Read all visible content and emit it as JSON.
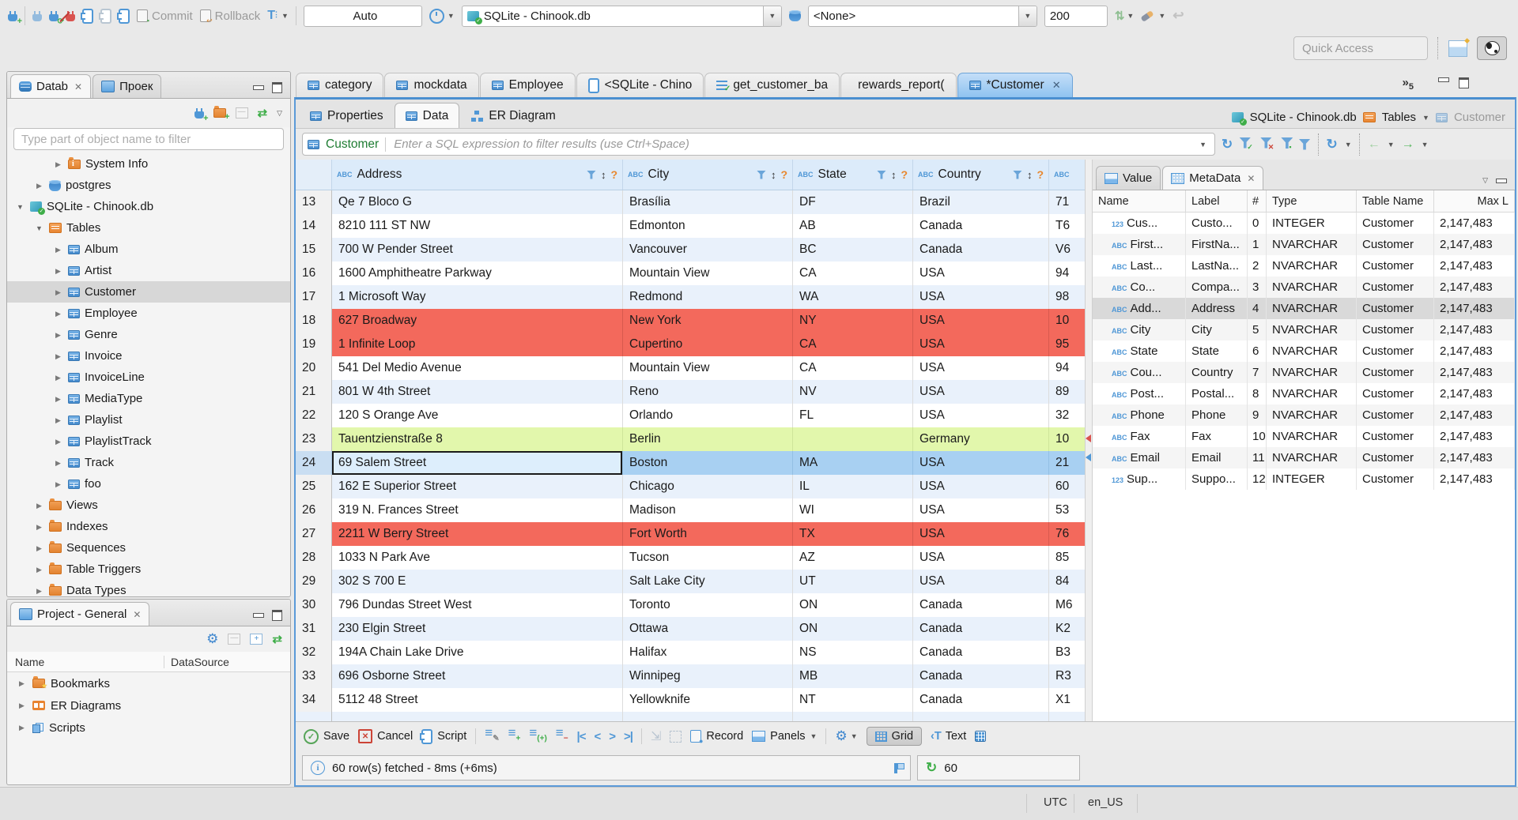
{
  "colors": {
    "accent_blue": "#4a8fd0",
    "selection_blue": "#a8d0f2",
    "row_red": "#f3695c",
    "row_green": "#e2f7ac",
    "row_stripe": "#e9f1fb",
    "header_blue": "#dcebfa",
    "entity_green": "#1f7d33",
    "folder_orange": "#e8832f"
  },
  "topbar": {
    "commit_label": "Commit",
    "rollback_label": "Rollback",
    "txn_mode": "Auto",
    "connection": "SQLite - Chinook.db",
    "schema": "<None>",
    "fetch_size": "200",
    "quick_access": "Quick Access"
  },
  "left": {
    "tabs": {
      "database": "Datab",
      "project": "Проек"
    },
    "filter_placeholder": "Type part of object name to filter",
    "tree": [
      {
        "label": "System Info",
        "indent": "ind2",
        "icon": "ic-folder ic-folderi",
        "arrow": "ar",
        "state": ""
      },
      {
        "label": "postgres",
        "indent": "ind1",
        "icon": "ic-db",
        "arrow": "ar",
        "state": ""
      },
      {
        "label": "SQLite - Chinook.db",
        "indent": "ind0",
        "icon": "ic-sqlite",
        "arrow": "ad",
        "state": ""
      },
      {
        "label": "Tables",
        "indent": "ind1",
        "icon": "ic-ftable",
        "arrow": "ad",
        "state": ""
      },
      {
        "label": "Album",
        "indent": "ind2",
        "icon": "ic-table",
        "arrow": "ar",
        "state": ""
      },
      {
        "label": "Artist",
        "indent": "ind2",
        "icon": "ic-table",
        "arrow": "ar",
        "state": ""
      },
      {
        "label": "Customer",
        "indent": "ind2",
        "icon": "ic-table",
        "arrow": "ar",
        "state": "sel"
      },
      {
        "label": "Employee",
        "indent": "ind2",
        "icon": "ic-table",
        "arrow": "ar",
        "state": ""
      },
      {
        "label": "Genre",
        "indent": "ind2",
        "icon": "ic-table",
        "arrow": "ar",
        "state": ""
      },
      {
        "label": "Invoice",
        "indent": "ind2",
        "icon": "ic-table",
        "arrow": "ar",
        "state": ""
      },
      {
        "label": "InvoiceLine",
        "indent": "ind2",
        "icon": "ic-table",
        "arrow": "ar",
        "state": ""
      },
      {
        "label": "MediaType",
        "indent": "ind2",
        "icon": "ic-table",
        "arrow": "ar",
        "state": ""
      },
      {
        "label": "Playlist",
        "indent": "ind2",
        "icon": "ic-table",
        "arrow": "ar",
        "state": ""
      },
      {
        "label": "PlaylistTrack",
        "indent": "ind2",
        "icon": "ic-table",
        "arrow": "ar",
        "state": ""
      },
      {
        "label": "Track",
        "indent": "ind2",
        "icon": "ic-table",
        "arrow": "ar",
        "state": ""
      },
      {
        "label": "foo",
        "indent": "ind2",
        "icon": "ic-table",
        "arrow": "ar",
        "state": ""
      },
      {
        "label": "Views",
        "indent": "ind1",
        "icon": "ic-folder",
        "arrow": "ar",
        "state": ""
      },
      {
        "label": "Indexes",
        "indent": "ind1",
        "icon": "ic-folder",
        "arrow": "ar",
        "state": ""
      },
      {
        "label": "Sequences",
        "indent": "ind1",
        "icon": "ic-folder",
        "arrow": "ar",
        "state": ""
      },
      {
        "label": "Table Triggers",
        "indent": "ind1",
        "icon": "ic-folder",
        "arrow": "ar",
        "state": ""
      },
      {
        "label": "Data Types",
        "indent": "ind1",
        "icon": "ic-folder",
        "arrow": "ar",
        "state": ""
      }
    ]
  },
  "project": {
    "title": "Project - General",
    "col_name": "Name",
    "col_datasource": "DataSource",
    "rows": [
      {
        "label": "Bookmarks",
        "icon": "ic-folder ic-fstar"
      },
      {
        "label": "ER Diagrams",
        "icon": "ic-er"
      },
      {
        "label": "Scripts",
        "icon": "ic-scripts"
      }
    ]
  },
  "editor": {
    "tabs": [
      {
        "label": "category",
        "icon": "ic-table",
        "state": ""
      },
      {
        "label": "mockdata",
        "icon": "ic-table",
        "state": ""
      },
      {
        "label": "Employee",
        "icon": "ic-table",
        "state": ""
      },
      {
        "label": "<SQLite - Chino",
        "icon": "ic-sql",
        "state": ""
      },
      {
        "label": "get_customer_ba",
        "icon": "ic-scr",
        "state": ""
      },
      {
        "label": "rewards_report(",
        "icon": "ic-fn",
        "state": ""
      },
      {
        "label": "*Customer",
        "icon": "ic-table",
        "state": "t-active"
      }
    ],
    "overflow_count": "5",
    "subtabs": [
      {
        "label": "Properties",
        "icon": "ic-table",
        "state": ""
      },
      {
        "label": "Data",
        "icon": "ic-table",
        "state": "st-active"
      },
      {
        "label": "ER Diagram",
        "icon": "ic-erd",
        "state": ""
      }
    ],
    "breadcrumb": {
      "connection": "SQLite - Chinook.db",
      "container": "Tables",
      "entity": "Customer"
    },
    "filter": {
      "entity": "Customer",
      "placeholder": "Enter a SQL expression to filter results (use Ctrl+Space)"
    }
  },
  "grid": {
    "columns": [
      "Address",
      "City",
      "State",
      "Country"
    ],
    "rows": [
      {
        "num": "13",
        "address": "Qe 7 Bloco G",
        "city": "Brasília",
        "state": "DF",
        "country": "Brazil",
        "extra": "71",
        "rowcls": "r-blue"
      },
      {
        "num": "14",
        "address": "8210 111 ST NW",
        "city": "Edmonton",
        "state": "AB",
        "country": "Canada",
        "extra": "T6",
        "rowcls": "r-white"
      },
      {
        "num": "15",
        "address": "700 W Pender Street",
        "city": "Vancouver",
        "state": "BC",
        "country": "Canada",
        "extra": "V6",
        "rowcls": "r-blue"
      },
      {
        "num": "16",
        "address": "1600 Amphitheatre Parkway",
        "city": "Mountain View",
        "state": "CA",
        "country": "USA",
        "extra": "94",
        "rowcls": "r-white"
      },
      {
        "num": "17",
        "address": "1 Microsoft Way",
        "city": "Redmond",
        "state": "WA",
        "country": "USA",
        "extra": "98",
        "rowcls": "r-blue"
      },
      {
        "num": "18",
        "address": "627 Broadway",
        "city": "New York",
        "state": "NY",
        "country": "USA",
        "extra": "10",
        "rowcls": "r-red"
      },
      {
        "num": "19",
        "address": "1 Infinite Loop",
        "city": "Cupertino",
        "state": "CA",
        "country": "USA",
        "extra": "95",
        "rowcls": "r-red"
      },
      {
        "num": "20",
        "address": "541 Del Medio Avenue",
        "city": "Mountain View",
        "state": "CA",
        "country": "USA",
        "extra": "94",
        "rowcls": "r-white"
      },
      {
        "num": "21",
        "address": "801 W 4th Street",
        "city": "Reno",
        "state": "NV",
        "country": "USA",
        "extra": "89",
        "rowcls": "r-blue"
      },
      {
        "num": "22",
        "address": "120 S Orange Ave",
        "city": "Orlando",
        "state": "FL",
        "country": "USA",
        "extra": "32",
        "rowcls": "r-white"
      },
      {
        "num": "23",
        "address": "Tauentzienstraße 8",
        "city": "Berlin",
        "state": "",
        "country": "Germany",
        "extra": "10",
        "rowcls": "r-green"
      },
      {
        "num": "24",
        "address": "69 Salem Street",
        "city": "Boston",
        "state": "MA",
        "country": "USA",
        "extra": "21",
        "rowcls": "r-sel"
      },
      {
        "num": "25",
        "address": "162 E Superior Street",
        "city": "Chicago",
        "state": "IL",
        "country": "USA",
        "extra": "60",
        "rowcls": "r-blue"
      },
      {
        "num": "26",
        "address": "319 N. Frances Street",
        "city": "Madison",
        "state": "WI",
        "country": "USA",
        "extra": "53",
        "rowcls": "r-white"
      },
      {
        "num": "27",
        "address": "2211 W Berry Street",
        "city": "Fort Worth",
        "state": "TX",
        "country": "USA",
        "extra": "76",
        "rowcls": "r-red"
      },
      {
        "num": "28",
        "address": "1033 N Park Ave",
        "city": "Tucson",
        "state": "AZ",
        "country": "USA",
        "extra": "85",
        "rowcls": "r-white"
      },
      {
        "num": "29",
        "address": "302 S 700 E",
        "city": "Salt Lake City",
        "state": "UT",
        "country": "USA",
        "extra": "84",
        "rowcls": "r-blue"
      },
      {
        "num": "30",
        "address": "796 Dundas Street West",
        "city": "Toronto",
        "state": "ON",
        "country": "Canada",
        "extra": "M6",
        "rowcls": "r-white"
      },
      {
        "num": "31",
        "address": "230 Elgin Street",
        "city": "Ottawa",
        "state": "ON",
        "country": "Canada",
        "extra": "K2",
        "rowcls": "r-blue"
      },
      {
        "num": "32",
        "address": "194A Chain Lake Drive",
        "city": "Halifax",
        "state": "NS",
        "country": "Canada",
        "extra": "B3",
        "rowcls": "r-white"
      },
      {
        "num": "33",
        "address": "696 Osborne Street",
        "city": "Winnipeg",
        "state": "MB",
        "country": "Canada",
        "extra": "R3",
        "rowcls": "r-blue"
      },
      {
        "num": "34",
        "address": "5112 48 Street",
        "city": "Yellowknife",
        "state": "NT",
        "country": "Canada",
        "extra": "X1",
        "rowcls": "r-white"
      },
      {
        "num": "",
        "address": "",
        "city": "",
        "state": "",
        "country": "",
        "extra": "",
        "rowcls": "r-partial"
      }
    ]
  },
  "metadata": {
    "tab_value": "Value",
    "tab_metadata": "MetaData",
    "columns": {
      "name": "Name",
      "label": "Label",
      "num": "#",
      "type": "Type",
      "table": "Table Name",
      "max": "Max L"
    },
    "rows": [
      {
        "icon": "ic-123",
        "name": "Cus...",
        "label": "Custo...",
        "num": "0",
        "type": "INTEGER",
        "table": "Customer",
        "max": "2,147,483",
        "state": ""
      },
      {
        "icon": "ic-abc",
        "name": "First...",
        "label": "FirstNa...",
        "num": "1",
        "type": "NVARCHAR",
        "table": "Customer",
        "max": "2,147,483",
        "state": ""
      },
      {
        "icon": "ic-abc",
        "name": "Last...",
        "label": "LastNa...",
        "num": "2",
        "type": "NVARCHAR",
        "table": "Customer",
        "max": "2,147,483",
        "state": ""
      },
      {
        "icon": "ic-abc",
        "name": "Co...",
        "label": "Compa...",
        "num": "3",
        "type": "NVARCHAR",
        "table": "Customer",
        "max": "2,147,483",
        "state": ""
      },
      {
        "icon": "ic-abc",
        "name": "Add...",
        "label": "Address",
        "num": "4",
        "type": "NVARCHAR",
        "table": "Customer",
        "max": "2,147,483",
        "state": "msel"
      },
      {
        "icon": "ic-abc",
        "name": "City",
        "label": "City",
        "num": "5",
        "type": "NVARCHAR",
        "table": "Customer",
        "max": "2,147,483",
        "state": ""
      },
      {
        "icon": "ic-abc",
        "name": "State",
        "label": "State",
        "num": "6",
        "type": "NVARCHAR",
        "table": "Customer",
        "max": "2,147,483",
        "state": ""
      },
      {
        "icon": "ic-abc",
        "name": "Cou...",
        "label": "Country",
        "num": "7",
        "type": "NVARCHAR",
        "table": "Customer",
        "max": "2,147,483",
        "state": ""
      },
      {
        "icon": "ic-abc",
        "name": "Post...",
        "label": "Postal...",
        "num": "8",
        "type": "NVARCHAR",
        "table": "Customer",
        "max": "2,147,483",
        "state": ""
      },
      {
        "icon": "ic-abc",
        "name": "Phone",
        "label": "Phone",
        "num": "9",
        "type": "NVARCHAR",
        "table": "Customer",
        "max": "2,147,483",
        "state": ""
      },
      {
        "icon": "ic-abc",
        "name": "Fax",
        "label": "Fax",
        "num": "10",
        "type": "NVARCHAR",
        "table": "Customer",
        "max": "2,147,483",
        "state": ""
      },
      {
        "icon": "ic-abc",
        "name": "Email",
        "label": "Email",
        "num": "11",
        "type": "NVARCHAR",
        "table": "Customer",
        "max": "2,147,483",
        "state": ""
      },
      {
        "icon": "ic-123",
        "name": "Sup...",
        "label": "Suppo...",
        "num": "12",
        "type": "INTEGER",
        "table": "Customer",
        "max": "2,147,483",
        "state": ""
      }
    ]
  },
  "bottom": {
    "save": "Save",
    "cancel": "Cancel",
    "script": "Script",
    "record": "Record",
    "panels": "Panels",
    "grid": "Grid",
    "text": "Text",
    "fetch_status": "60 row(s) fetched - 8ms (+6ms)",
    "refresh_value": "60"
  },
  "statusbar": {
    "timezone": "UTC",
    "locale": "en_US"
  }
}
